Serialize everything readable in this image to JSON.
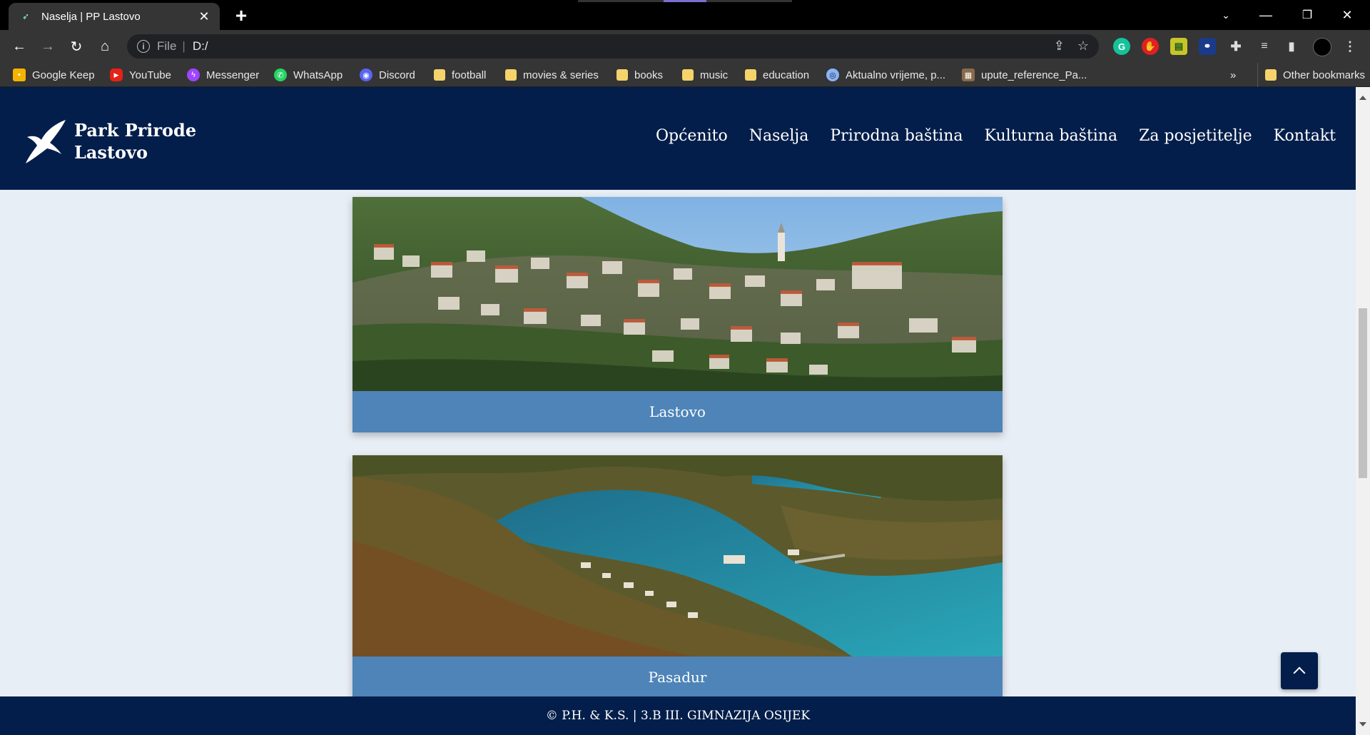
{
  "browser": {
    "tab_title": "Naselja | PP Lastovo",
    "tab_favicon": "bird-icon",
    "address_scheme": "File",
    "address_url": "D:/",
    "bookmarks": [
      {
        "label": "Google Keep",
        "icon": "keep-icon",
        "color": "#f6b400"
      },
      {
        "label": "YouTube",
        "icon": "youtube-icon",
        "color": "#e62117"
      },
      {
        "label": "Messenger",
        "icon": "messenger-icon",
        "color": "#a044ff"
      },
      {
        "label": "WhatsApp",
        "icon": "whatsapp-icon",
        "color": "#25d366"
      },
      {
        "label": "Discord",
        "icon": "discord-icon",
        "color": "#5865f2"
      },
      {
        "label": "football",
        "icon": "folder-icon"
      },
      {
        "label": "movies & series",
        "icon": "folder-icon"
      },
      {
        "label": "books",
        "icon": "folder-icon"
      },
      {
        "label": "music",
        "icon": "folder-icon"
      },
      {
        "label": "education",
        "icon": "folder-icon"
      },
      {
        "label": "Aktualno vrijeme, p...",
        "icon": "globe-icon",
        "color": "#8ab4f8"
      },
      {
        "label": "upute_reference_Pa...",
        "icon": "page-icon",
        "color": "#8a6a4a"
      }
    ],
    "overflow_label": "»",
    "other_bookmarks": "Other bookmarks"
  },
  "site": {
    "logo_line1": "Park Prirode",
    "logo_line2": "Lastovo",
    "nav": [
      "Općenito",
      "Naselja",
      "Prirodna baština",
      "Kulturna baština",
      "Za posjetitelje",
      "Kontakt"
    ],
    "cards": [
      {
        "caption": "Lastovo"
      },
      {
        "caption": "Pasadur"
      }
    ],
    "footer": "© P.H. & K.S. | 3.B III. GIMNAZIJA OSIJEK"
  },
  "colors": {
    "header_bg": "#031e4a",
    "caption_bg": "#4e84b8",
    "page_bg": "#e8eef5"
  }
}
